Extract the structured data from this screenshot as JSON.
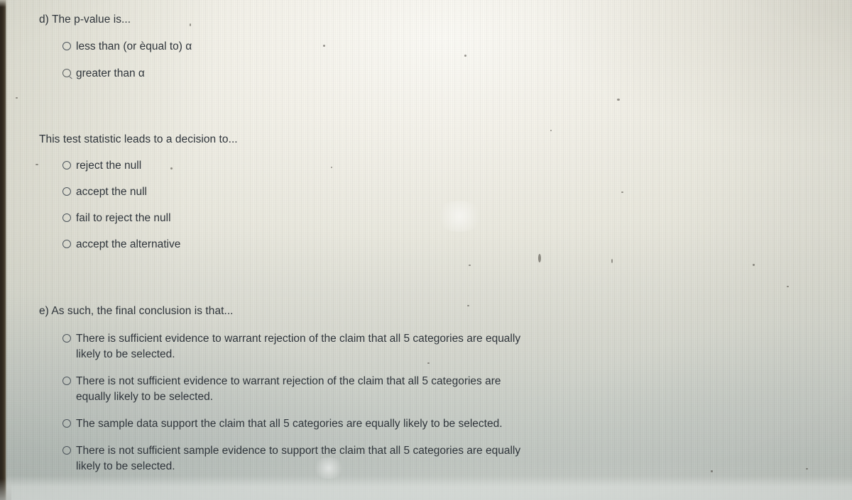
{
  "page": {
    "background_light": "#f6f4ed",
    "background_mid": "#dcdcd2",
    "background_shadow": "#c3c8c3",
    "text_color": "#2f353b",
    "bezel_color": "#2a241c"
  },
  "questions": [
    {
      "id": "d",
      "prompt": "d) The p-value is...",
      "options": [
        {
          "label": "less than (or èqual to) α",
          "selected": false,
          "radio_state": "empty"
        },
        {
          "label": "greater than α",
          "selected": false,
          "radio_state": "smudged"
        }
      ]
    },
    {
      "id": "decision",
      "prompt": "This test statistic leads to a decision to...",
      "options": [
        {
          "label": "reject the null",
          "selected": false,
          "radio_state": "empty"
        },
        {
          "label": "accept the null",
          "selected": false,
          "radio_state": "empty"
        },
        {
          "label": "fail to reject the null",
          "selected": false,
          "radio_state": "empty"
        },
        {
          "label": "accept the alternative",
          "selected": false,
          "radio_state": "empty"
        }
      ]
    },
    {
      "id": "e",
      "prompt": "e) As such, the final conclusion is that...",
      "options": [
        {
          "line1": "There is sufficient evidence to warrant rejection of the claim that all 5 categories are equally",
          "line2": "likely to be selected.",
          "selected": false,
          "radio_state": "empty"
        },
        {
          "line1": "There is not sufficient evidence to warrant rejection of the claim that all 5 categories are",
          "line2": "equally likely to be selected.",
          "selected": false,
          "radio_state": "empty"
        },
        {
          "line1": "The sample data support the claim that all 5 categories are equally likely to be selected.",
          "line2": "",
          "selected": false,
          "radio_state": "empty"
        },
        {
          "line1": "There is not sufficient sample evidence to support the claim that all 5 categories are equally",
          "line2": "likely to be selected.",
          "selected": false,
          "radio_state": "empty"
        }
      ]
    }
  ]
}
